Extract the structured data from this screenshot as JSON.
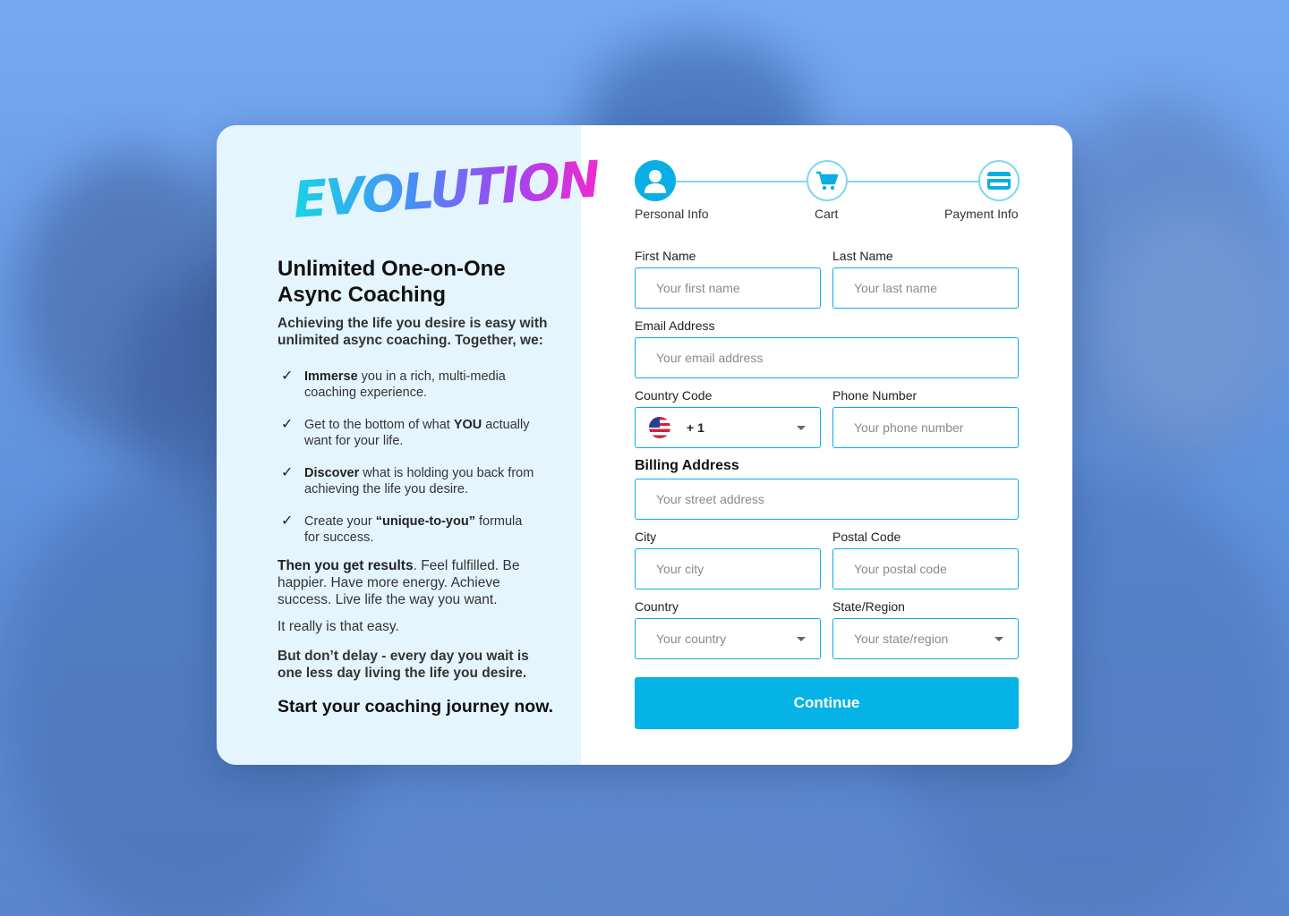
{
  "brand": {
    "logo_text": "EVOLUTION",
    "colors": {
      "accent": "#06b3e6",
      "left_panel": "#e5f5fd",
      "background": "#6d9ee6"
    }
  },
  "left": {
    "headline": "Unlimited One-on-One Async Coaching",
    "intro": "Achieving the life you desire is easy with unlimited async coaching. Together, we:",
    "bullets": [
      {
        "bold": "Immerse",
        "text": " you in a rich, multi-media coaching experience."
      },
      {
        "pre": "Get to the bottom of what ",
        "bold": "YOU",
        "text": " actually want for your life."
      },
      {
        "bold": "Discover",
        "text": " what is holding you back from achieving the life you desire."
      },
      {
        "pre": "Create your ",
        "bold": "“unique-to-you”",
        "text": " formula for success."
      }
    ],
    "results_bold": "Then you get results",
    "results_text": ". Feel fulfilled. Be happier. Have more energy. Achieve success. Live life the way you want.",
    "easy": "It really is that easy.",
    "delay": "But don’t delay - every day you wait is one less day living the life you desire.",
    "cta": "Start your coaching journey now."
  },
  "stepper": {
    "steps": [
      {
        "label": "Personal Info",
        "icon": "user-icon",
        "active": true
      },
      {
        "label": "Cart",
        "icon": "cart-icon",
        "active": false
      },
      {
        "label": "Payment Info",
        "icon": "credit-card-icon",
        "active": false
      }
    ]
  },
  "form": {
    "first_name": {
      "label": "First Name",
      "placeholder": "Your first name"
    },
    "last_name": {
      "label": "Last Name",
      "placeholder": "Your last name"
    },
    "email": {
      "label": "Email Address",
      "placeholder": "Your email address"
    },
    "country_code": {
      "label": "Country Code",
      "value": "+ 1",
      "flag": "us-flag-icon"
    },
    "phone": {
      "label": "Phone Number",
      "placeholder": "Your phone number"
    },
    "billing_title": "Billing Address",
    "street": {
      "placeholder": "Your street address"
    },
    "city": {
      "label": "City",
      "placeholder": "Your city"
    },
    "postal": {
      "label": "Postal Code",
      "placeholder": "Your postal code"
    },
    "country": {
      "label": "Country",
      "value": "Your country"
    },
    "state": {
      "label": "State/Region",
      "value": "Your state/region"
    },
    "submit_label": "Continue"
  }
}
